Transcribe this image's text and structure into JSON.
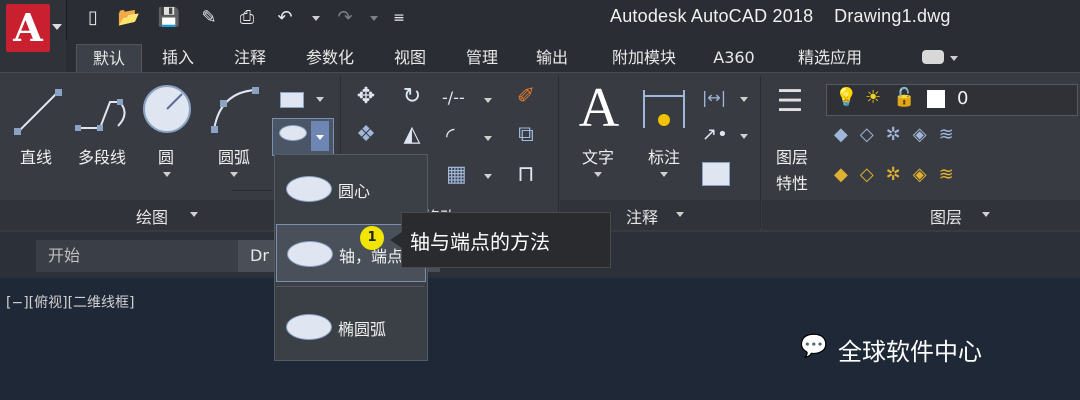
{
  "titlebar": {
    "app_title": "Autodesk AutoCAD 2018",
    "document": "Drawing1.dwg",
    "logo_letter": "A"
  },
  "ribbon_tabs": [
    "默认",
    "插入",
    "注释",
    "参数化",
    "视图",
    "管理",
    "输出",
    "附加模块",
    "A360",
    "精选应用"
  ],
  "draw_panel": {
    "title": "绘图",
    "tools": [
      "直线",
      "多段线",
      "圆",
      "圆弧"
    ]
  },
  "modify_panel": {
    "title": "修改"
  },
  "annotation_panel": {
    "title": "注释",
    "tools": [
      "文字",
      "标注"
    ]
  },
  "layers_panel": {
    "title": "图层",
    "tool_line1": "图层",
    "tool_line2": "特性",
    "layer_value": "0"
  },
  "ellipse_menu": {
    "items": [
      "圆心",
      "轴，端点",
      "椭圆弧"
    ]
  },
  "tooltip": {
    "badge": "1",
    "text": "轴与端点的方法"
  },
  "file_tabs": [
    "开始",
    "Dr"
  ],
  "viewport_label": "[−][俯视][二维线框]",
  "watermark": "全球软件中心",
  "colors": {
    "accent": "#c8202f",
    "badge": "#f2e600",
    "canvas": "#1f2837"
  }
}
